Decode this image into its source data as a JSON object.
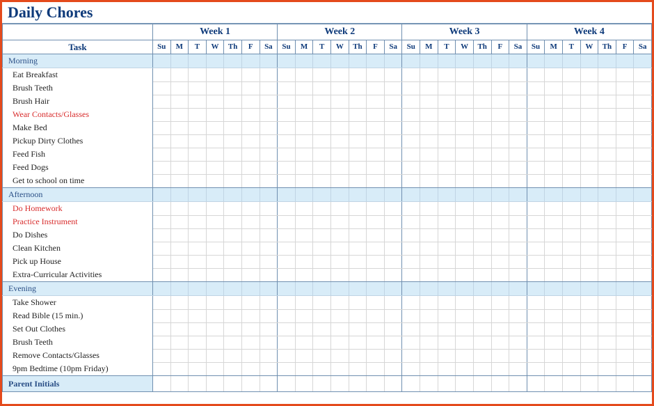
{
  "title": "Daily Chores",
  "task_header": "Task",
  "weeks": [
    "Week 1",
    "Week 2",
    "Week 3",
    "Week 4"
  ],
  "days": [
    "Su",
    "M",
    "T",
    "W",
    "Th",
    "F",
    "Sa"
  ],
  "sections": [
    {
      "name": "Morning",
      "tasks": [
        {
          "label": "Eat Breakfast",
          "highlight": false
        },
        {
          "label": "Brush Teeth",
          "highlight": false
        },
        {
          "label": "Brush Hair",
          "highlight": false
        },
        {
          "label": "Wear Contacts/Glasses",
          "highlight": true
        },
        {
          "label": "Make Bed",
          "highlight": false
        },
        {
          "label": "Pickup Dirty Clothes",
          "highlight": false
        },
        {
          "label": "Feed Fish",
          "highlight": false
        },
        {
          "label": "Feed Dogs",
          "highlight": false
        },
        {
          "label": "Get to school on time",
          "highlight": false
        }
      ]
    },
    {
      "name": "Afternoon",
      "tasks": [
        {
          "label": "Do Homework",
          "highlight": true
        },
        {
          "label": "Practice Instrument",
          "highlight": true
        },
        {
          "label": "Do Dishes",
          "highlight": false
        },
        {
          "label": "Clean Kitchen",
          "highlight": false
        },
        {
          "label": "Pick up House",
          "highlight": false
        },
        {
          "label": "Extra-Curricular Activities",
          "highlight": false
        }
      ]
    },
    {
      "name": "Evening",
      "tasks": [
        {
          "label": "Take Shower",
          "highlight": false
        },
        {
          "label": "Read Bible (15 min.)",
          "highlight": false
        },
        {
          "label": "Set Out Clothes",
          "highlight": false
        },
        {
          "label": "Brush Teeth",
          "highlight": false
        },
        {
          "label": "Remove Contacts/Glasses",
          "highlight": false
        },
        {
          "label": "9pm Bedtime (10pm Friday)",
          "highlight": false
        }
      ]
    }
  ],
  "footer": "Parent Initials"
}
